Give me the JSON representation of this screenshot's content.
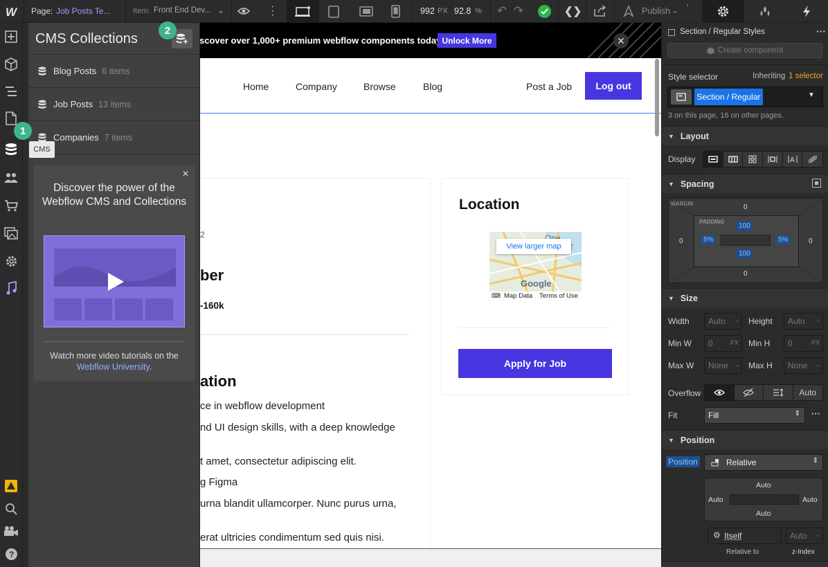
{
  "topbar": {
    "page_label": "Page:",
    "page_name": "Job Posts Te...",
    "item_label": "Item:",
    "item_name": "Front End Dev...",
    "width_value": "992",
    "width_unit": "PX",
    "zoom_value": "92.8",
    "zoom_unit": "%",
    "publish_label": "Publish"
  },
  "rail": {
    "tooltip": "CMS",
    "icons": [
      "webflow-logo-icon",
      "add-icon",
      "cube-icon",
      "navigator-icon",
      "pages-icon",
      "cms-database-icon",
      "users-icon",
      "ecommerce-cart-icon",
      "assets-icon",
      "settings-gear-icon",
      "audit-icon",
      "warning-icon",
      "search-icon",
      "video-tutorial-icon",
      "help-icon"
    ]
  },
  "cms": {
    "title": "CMS Collections",
    "collections": [
      {
        "name": "Blog Posts",
        "count": "6 items"
      },
      {
        "name": "Job Posts",
        "count": "13 items"
      },
      {
        "name": "Companies",
        "count": "7 items"
      }
    ],
    "badge1": "1",
    "badge2": "2",
    "promo": {
      "title": "Discover the power of the Webflow CMS and Collections",
      "footer": "Watch more video tutorials on the",
      "link": "Webflow University",
      "link_suffix": "."
    }
  },
  "canvas": {
    "banner_text": "scover over 1,000+ premium webflow components today!",
    "banner_button": "Unlock More",
    "nav": [
      "Home",
      "Company",
      "Browse",
      "Blog"
    ],
    "post_job": "Post a Job",
    "logout": "Log out",
    "frag_2": "2",
    "frag_ber": "ber",
    "frag_salary": "-160k",
    "frag_ation": "ation",
    "body_lines": [
      "ce in webflow development",
      "nd UI design skills, with a deep knowledge",
      "t amet, consectetur adipiscing elit.",
      "g Figma",
      "urna blandit ullamcorper. Nunc purus urna,",
      "erat ultricies condimentum sed quis nisi."
    ],
    "location_title": "Location",
    "map_link": "View larger map",
    "map_data": "Map Data",
    "map_terms": "Terms of Use",
    "map_brand": "Google",
    "map_place": "One World T",
    "apply_button": "Apply for Job"
  },
  "style": {
    "selector_title": "Section / Regular Styles",
    "create_component": "Create component",
    "style_selector_label": "Style selector",
    "inheriting_label": "Inheriting",
    "inheriting_count": "1 selector",
    "selector_chip": "Section / Regular",
    "usage_note": "3 on this page, 16 on other pages.",
    "layout": {
      "header": "Layout",
      "display_label": "Display"
    },
    "spacing": {
      "header": "Spacing",
      "margin_label": "MARGIN",
      "padding_label": "PADDING",
      "margin": {
        "top": "0",
        "right": "0",
        "bottom": "0",
        "left": "0"
      },
      "padding": {
        "top": "100",
        "right": "5%",
        "bottom": "100",
        "left": "5%"
      }
    },
    "size": {
      "header": "Size",
      "width_label": "Width",
      "width_val": "Auto",
      "height_label": "Height",
      "height_val": "Auto",
      "minw_label": "Min W",
      "minw_val": "0",
      "minw_unit": "PX",
      "minh_label": "Min H",
      "minh_val": "0",
      "minh_unit": "PX",
      "maxw_label": "Max W",
      "maxw_val": "None",
      "maxh_label": "Max H",
      "maxh_val": "None",
      "overflow_label": "Overflow",
      "overflow_auto": "Auto",
      "fit_label": "Fit",
      "fit_val": "Fill"
    },
    "position": {
      "header": "Position",
      "position_label": "Position",
      "position_val": "Relative",
      "top": "Auto",
      "left": "Auto",
      "right": "Auto",
      "bottom": "Auto",
      "relative_item": "Itself",
      "zindex_val": "Auto",
      "relative_to_label": "Relative to",
      "zindex_label": "z-Index"
    }
  },
  "colors": {
    "accent": "#4836e0",
    "brand_blue": "#1a73e8",
    "green": "#3fb48b",
    "orange": "#f5a623"
  }
}
